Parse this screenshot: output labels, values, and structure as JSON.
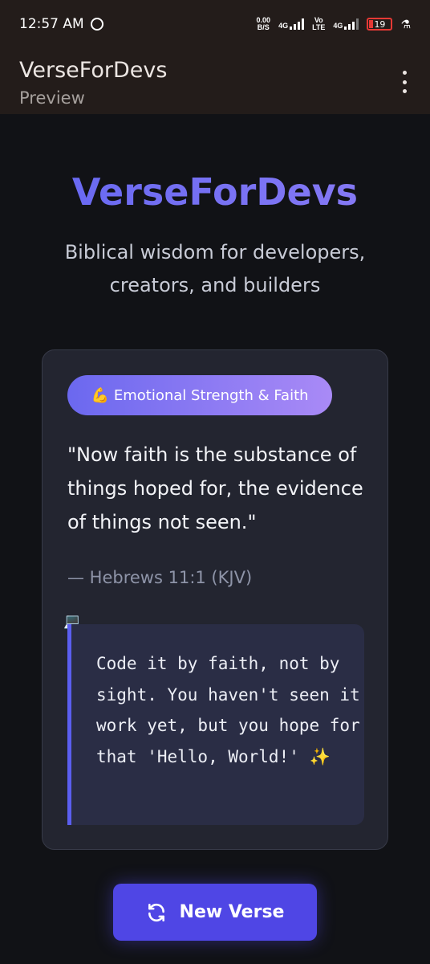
{
  "status_bar": {
    "time": "12:57 AM",
    "net_speed_value": "0.00",
    "net_speed_unit": "B/S",
    "network_1": "4G",
    "volte_1": "Vo",
    "volte_2": "LTE",
    "network_2": "4G",
    "battery": "19"
  },
  "app_bar": {
    "title": "VerseForDevs",
    "subtitle": "Preview"
  },
  "hero": {
    "title": "VerseForDevs",
    "subtitle": "Biblical wisdom for developers, creators, and builders"
  },
  "verse_card": {
    "category_emoji": "💪",
    "category": "Emotional Strength & Faith",
    "verse": "\"Now faith is the substance of things hoped for, the evidence of things not seen.\"",
    "reference": "— Hebrews 11:1 (KJV)",
    "dev_icon": "💻",
    "dev_note": "Code it by faith, not by sight. You haven't seen it work yet, but you hope for that 'Hello, World!' ✨"
  },
  "actions": {
    "new_verse_label": "New Verse"
  },
  "icons": {
    "refresh": "refresh-icon",
    "menu": "more-vert-icon"
  },
  "colors": {
    "accent": "#4f46e5",
    "title_gradient_start": "#6366f1",
    "title_gradient_end": "#8b7cf5",
    "background": "#111216",
    "card": "#232530"
  }
}
